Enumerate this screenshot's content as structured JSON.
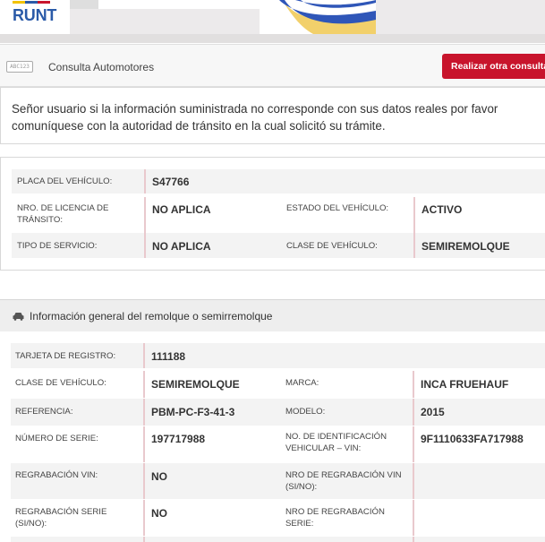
{
  "header": {
    "logo_text": "RUNT",
    "colors": {
      "brand_blue": "#2a5aa8",
      "accent_red": "#c8142c",
      "banner_yellow": "#f2d06b"
    }
  },
  "consulta": {
    "icon_text": "ABC123",
    "title": "Consulta Automotores",
    "action_label": "Realizar otra consulta"
  },
  "notice": {
    "text": "Señor usuario si la información suministrada no corresponde con sus datos reales por favor comuníquese con la autoridad de tránsito en la cual solicitó su trámite."
  },
  "vehicle": {
    "placa_label": "PLACA DEL VEHÍCULO:",
    "placa_value": "S47766",
    "licencia_label": "NRO. DE LICENCIA DE TRÁNSITO:",
    "licencia_value": "NO APLICA",
    "estado_label": "ESTADO DEL VEHÍCULO:",
    "estado_value": "ACTIVO",
    "servicio_label": "TIPO DE SERVICIO:",
    "servicio_value": "NO APLICA",
    "clase_label": "CLASE DE VEHÍCULO:",
    "clase_value": "SEMIREMOLQUE"
  },
  "remolque": {
    "section_title": "Información general del remolque o semirremolque",
    "tarjeta_label": "TARJETA DE REGISTRO:",
    "tarjeta_value": "111188",
    "clase_label": "CLASE DE VEHÍCULO:",
    "clase_value": "SEMIREMOLQUE",
    "marca_label": "MARCA:",
    "marca_value": "INCA FRUEHAUF",
    "referencia_label": "REFERENCIA:",
    "referencia_value": "PBM-PC-F3-41-3",
    "modelo_label": "MODELO:",
    "modelo_value": "2015",
    "serie_label": "NÚMERO DE SERIE:",
    "serie_value": "197717988",
    "vin_label": "NO. DE IDENTIFICACIÓN VEHICULAR – VIN:",
    "vin_value": "9F1110633FA717988",
    "regrab_vin_label": "REGRABACIÓN VIN:",
    "regrab_vin_value": "NO",
    "nro_regrab_vin_label": "NRO DE REGRABACIÓN VIN (SI/NO):",
    "regrab_serie_label": "REGRABACIÓN SERIE (SI/NO):",
    "regrab_serie_value": "NO",
    "nro_regrab_serie_label": "NRO DE REGRABACIÓN SERIE:"
  }
}
